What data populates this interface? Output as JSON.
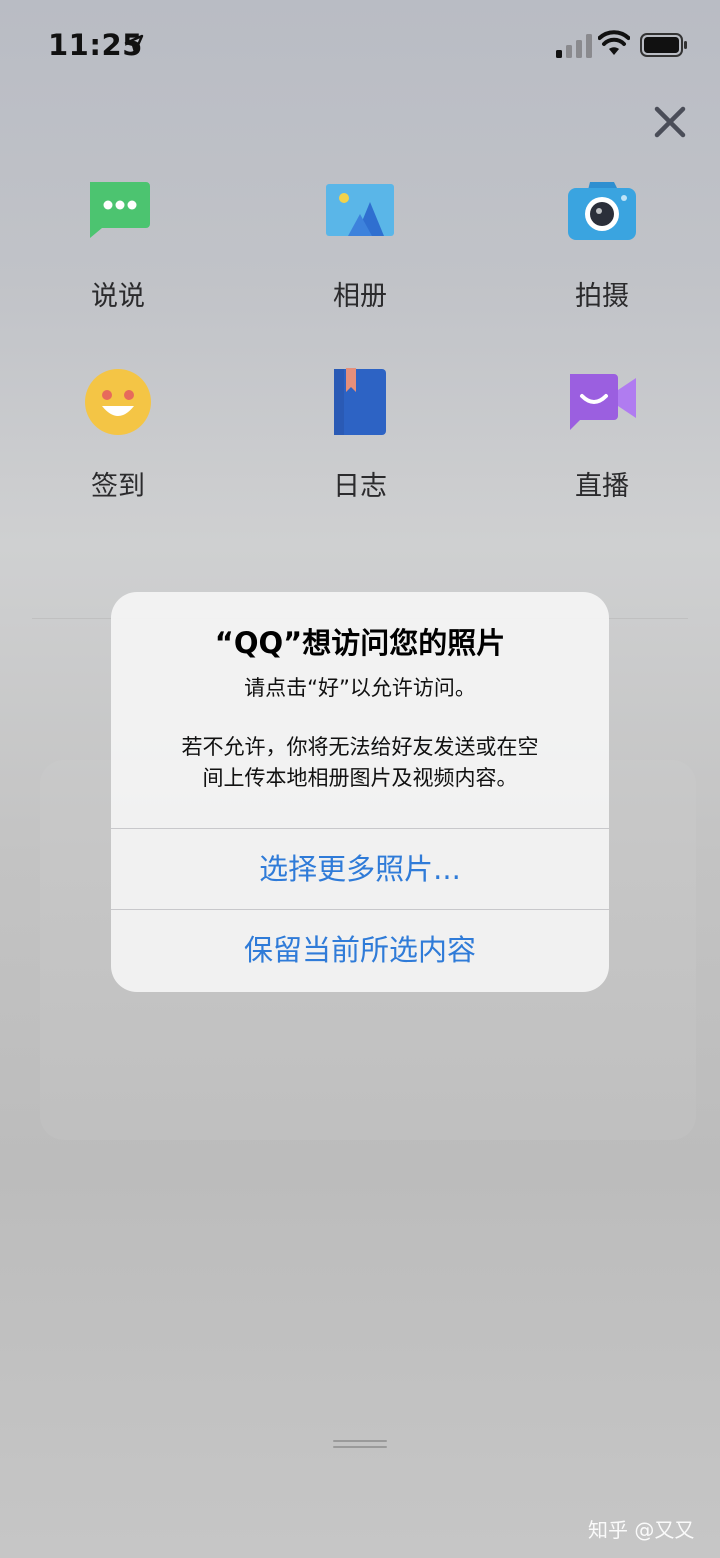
{
  "status_bar": {
    "time": "11:25",
    "icons": [
      "location-arrow-icon",
      "cellular-signal-icon",
      "wifi-icon",
      "battery-icon"
    ]
  },
  "close_icon": "close-icon",
  "actions": [
    {
      "label": "说说",
      "icon": "message-bubble-icon"
    },
    {
      "label": "相册",
      "icon": "photo-album-icon"
    },
    {
      "label": "拍摄",
      "icon": "camera-icon"
    },
    {
      "label": "签到",
      "icon": "smiley-face-icon"
    },
    {
      "label": "日志",
      "icon": "journal-book-icon"
    },
    {
      "label": "直播",
      "icon": "live-video-icon"
    }
  ],
  "alert": {
    "title": "“QQ”想访问您的照片",
    "subtitle": "请点击“好”以允许访问。",
    "message_line1": "若不允许，你将无法给好友发送或在空",
    "message_line2": "间上传本地相册图片及视频内容。",
    "buttons": [
      "选择更多照片...",
      "保留当前所选内容"
    ]
  },
  "watermark": "知乎 @又又",
  "colors": {
    "accent_blue": "#2f7bd8",
    "message_green": "#4cc470",
    "camera_blue": "#3aa4e0",
    "smiley_yellow": "#f4c545",
    "book_blue": "#2d63c4",
    "live_purple": "#9b5fe0"
  }
}
